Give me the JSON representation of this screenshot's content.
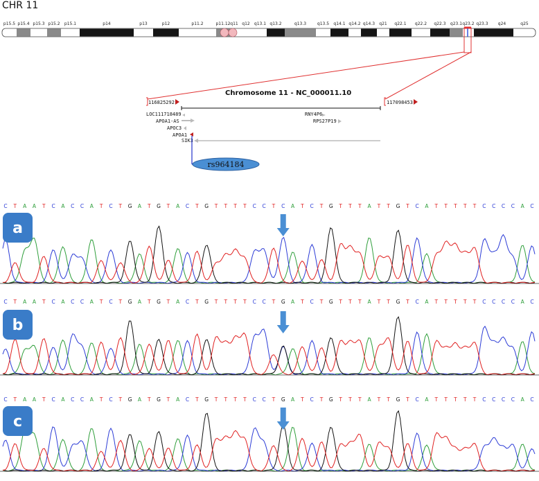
{
  "chromosome": {
    "label": "CHR 11",
    "bands": [
      "p15.5",
      "p15.4",
      "p15.3",
      "p15.2",
      "p15.1",
      "p14",
      "p13",
      "p12",
      "p11.2",
      "p11.12",
      "q11",
      "q12",
      "q13.1",
      "q13.2",
      "q13.3",
      "q13.5",
      "q14.1",
      "q14.2",
      "q14.3",
      "q21",
      "q22.1",
      "q22.2",
      "q22.3",
      "q23.1",
      "q23.2",
      "q23.3",
      "q24",
      "q25"
    ]
  },
  "region": {
    "title": "Chromosome 11 - NC_000011.10",
    "start": "116825292",
    "end": "117098453",
    "genes": [
      "LOC111718489",
      "APOA1-AS",
      "APOC3",
      "APOA1",
      "SIK3",
      "RNY4P6",
      "RPS27P19"
    ],
    "snp": "rs964184"
  },
  "sequence": "CTAATCACCATCTGATGTACTGTTTTCCTCATCTGTTTATTGTCATTTTTCCCCAC",
  "base_colors": {
    "A": "#2e9e3a",
    "C": "#2b3bd6",
    "G": "#111111",
    "T": "#e02020"
  },
  "panels": [
    {
      "label": "a",
      "call": "C",
      "heterozygous": false
    },
    {
      "label": "b",
      "call": "G",
      "heterozygous": true
    },
    {
      "label": "c",
      "call": "G",
      "heterozygous": false
    }
  ],
  "arrow_color": "#4a8fd4",
  "badge_color": "#3a7cc8"
}
